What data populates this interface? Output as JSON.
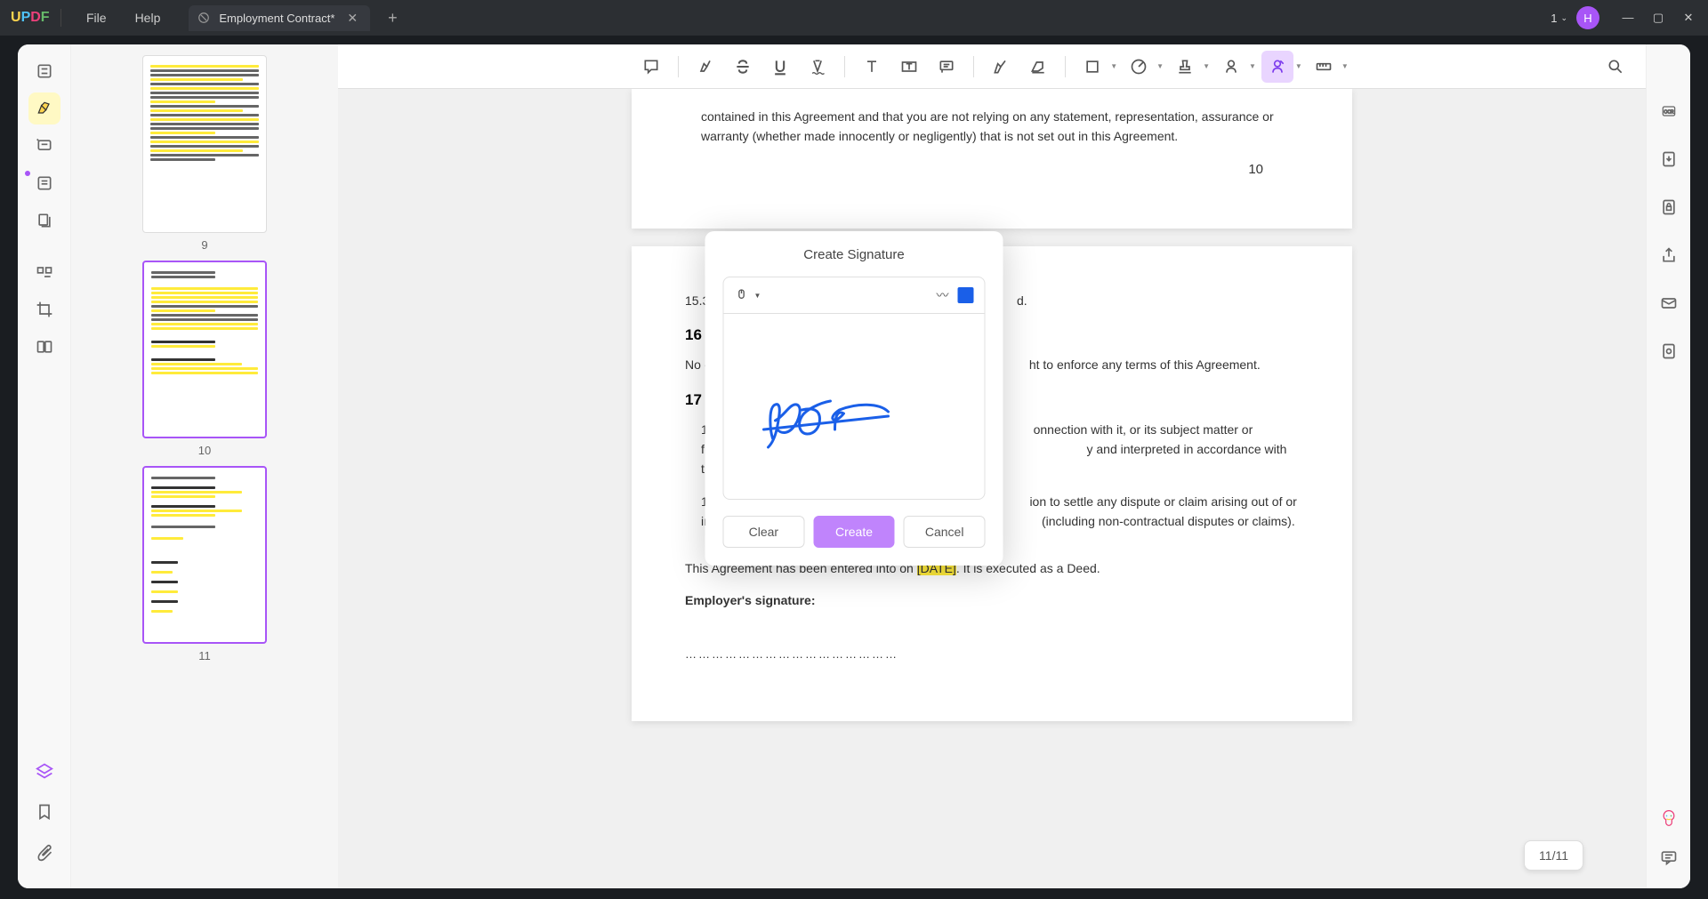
{
  "app": {
    "logo": "UPDF",
    "menu": {
      "file": "File",
      "help": "Help"
    },
    "tab": {
      "title": "Employment Contract*"
    },
    "badge_count": "1",
    "avatar_initial": "H"
  },
  "thumbnails": {
    "labels": [
      "9",
      "10",
      "11"
    ]
  },
  "document": {
    "partial_top": "contained in this Agreement and that you are not relying on any statement, representation, assurance or warranty (whether made innocently or negligently) that is not set out in this Agreement.",
    "page_num_top": "10",
    "sec_15_3_prefix": "15.3   Not",
    "sec_15_3_suffix": "d.",
    "sec_16_heading": "16   No",
    "sec_16_text_prefix": "No one o",
    "sec_16_text_suffix": "ht to enforce any terms of this Agreement.",
    "sec_17_heading": "17   Gov",
    "sec_17_1_prefix": "17.1Th",
    "sec_17_1_mid": "onnection with it, or its subject matter or formation (includ",
    "sec_17_1_suffix": "y and interpreted in accordance with the law of England and W",
    "sec_17_2_prefix": "17.2 T",
    "sec_17_2_mid": "ion to settle any dispute or claim arising out of or in conne",
    "sec_17_2_suffix": "(including non-contractual disputes or claims).",
    "entered_prefix": "This Agreement has been entered into on ",
    "entered_date": "[DATE]",
    "entered_suffix": ". It is executed as a Deed.",
    "employer_sig": "Employer's signature:",
    "sig_line": "…………………………………………"
  },
  "dialog": {
    "title": "Create Signature",
    "clear": "Clear",
    "create": "Create",
    "cancel": "Cancel"
  },
  "page_indicator": "11/11"
}
